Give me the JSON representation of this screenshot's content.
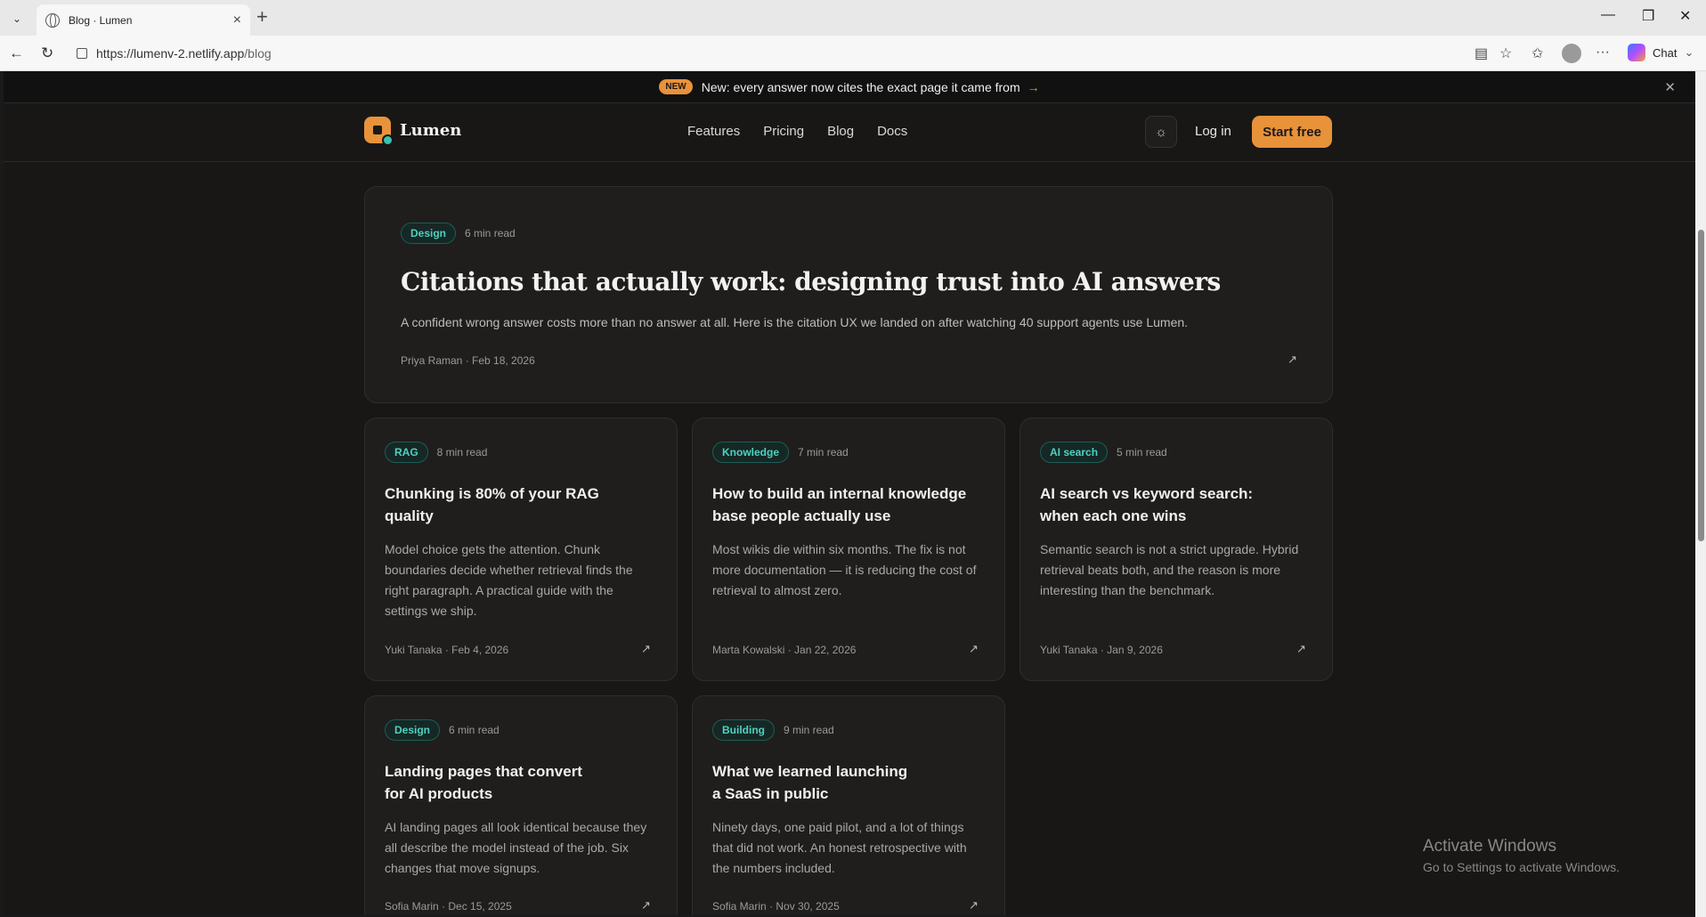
{
  "browser": {
    "tab_title": "Blog · Lumen",
    "url_host": "https://lumenv-2.netlify.app",
    "url_path": "/blog",
    "chat_label": "Chat"
  },
  "announcement": {
    "badge": "NEW",
    "message": "New: every answer now cites the exact page it came from",
    "arrow": "→"
  },
  "header": {
    "brand": "Lumen",
    "nav": [
      "Features",
      "Pricing",
      "Blog",
      "Docs"
    ],
    "login": "Log in",
    "cta": "Start free"
  },
  "featured": {
    "tag": "Design",
    "read_time": "6 min read",
    "title": "Citations that actually work: designing trust into AI answers",
    "description": "A confident wrong answer costs more than no answer at all. Here is the citation UX we landed on after watching 40 support agents use Lumen.",
    "meta": "Priya Raman · Feb 18, 2026"
  },
  "posts": [
    {
      "tag": "RAG",
      "read_time": "8 min read",
      "title": "Chunking is 80% of your RAG quality",
      "description": "Model choice gets the attention. Chunk boundaries decide whether retrieval finds the right paragraph. A practical guide with the settings we ship.",
      "meta": "Yuki Tanaka · Feb 4, 2026"
    },
    {
      "tag": "Knowledge",
      "read_time": "7 min read",
      "title": "How to build an internal knowledge base people actually use",
      "description": "Most wikis die within six months. The fix is not more documentation — it is reducing the cost of retrieval to almost zero.",
      "meta": "Marta Kowalski · Jan 22, 2026"
    },
    {
      "tag": "AI search",
      "read_time": "5 min read",
      "title": "AI search vs keyword search: when each one wins",
      "description": "Semantic search is not a strict upgrade. Hybrid retrieval beats both, and the reason is more interesting than the benchmark.",
      "meta": "Yuki Tanaka · Jan 9, 2026"
    },
    {
      "tag": "Design",
      "read_time": "6 min read",
      "title": "Landing pages that convert for AI products",
      "description": "AI landing pages all look identical because they all describe the model instead of the job. Six changes that move signups.",
      "meta": "Sofia Marin · Dec 15, 2025"
    },
    {
      "tag": "Building",
      "read_time": "9 min read",
      "title": "What we learned launching a SaaS in public",
      "description": "Ninety days, one paid pilot, and a lot of things that did not work. An honest retrospective with the numbers included.",
      "meta": "Sofia Marin · Nov 30, 2025"
    }
  ],
  "windows_watermark": {
    "line1": "Activate Windows",
    "line2": "Go to Settings to activate Windows."
  }
}
